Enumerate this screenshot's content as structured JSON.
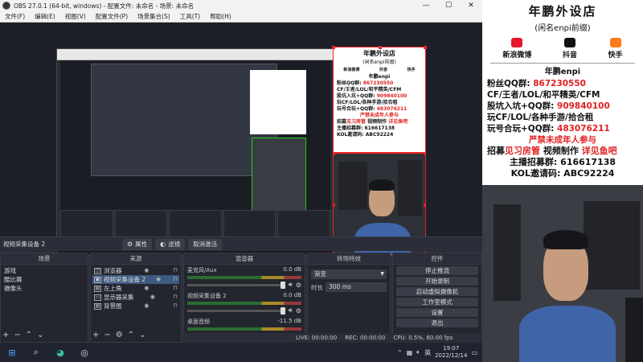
{
  "window": {
    "title": "OBS 27.0.1 (64-bit, windows) - 配置文件: 未命名 - 场景: 未命名",
    "controls": [
      "—",
      "☐",
      "✕"
    ]
  },
  "menu": [
    "文件(F)",
    "编辑(E)",
    "视图(V)",
    "配置文件(P)",
    "场景集合(S)",
    "工具(T)",
    "帮助(H)"
  ],
  "preview_header": {
    "source_name": "视频采集设备 2",
    "properties_label": "属性",
    "filters_label": "滤镜",
    "deactivate_label": "取消激活"
  },
  "scenes": {
    "title": "场景",
    "items": [
      "游戏",
      "酷比赛",
      "摄像头"
    ]
  },
  "sources": {
    "title": "来源",
    "items": [
      {
        "label": "浏览器",
        "icon": "browser-icon"
      },
      {
        "label": "视频采集设备 2",
        "icon": "camera-icon",
        "selected": true
      },
      {
        "label": "左上角",
        "icon": "image-icon"
      },
      {
        "label": "显示器采集",
        "icon": "monitor-icon"
      },
      {
        "label": "背景图",
        "icon": "image-icon"
      }
    ]
  },
  "mixer": {
    "title": "混音器",
    "channels": [
      {
        "name": "麦克风/Aux",
        "db": "0.0 dB"
      },
      {
        "name": "视频采集设备 2",
        "db": "0.0 dB"
      },
      {
        "name": "桌面音频",
        "db": "-11.5 dB"
      }
    ]
  },
  "transitions": {
    "title": "转场特效",
    "selected": "渐变",
    "duration_label": "时长",
    "duration_value": "300 ms"
  },
  "controls": {
    "title": "控件",
    "buttons": [
      "停止推流",
      "开始录制",
      "启动虚拟摄像机",
      "工作室模式",
      "设置",
      "退出"
    ]
  },
  "status": {
    "live": "LIVE: 00:00:00",
    "rec": "REC: 00:00:00",
    "cpu": "CPU: 0.5%, 60.00 fps"
  },
  "taskbar": {
    "time": "19:07",
    "date": "2022/12/14",
    "lang": "英"
  },
  "shop": {
    "title": "年鹏外设店",
    "subtitle": "(闲名enpi前缀)",
    "socials": [
      {
        "label": "新浪微博",
        "color": "#e6162d",
        "icon": "weibo-icon"
      },
      {
        "label": "抖音",
        "color": "#111111",
        "icon": "douyin-icon"
      },
      {
        "label": "快手",
        "color": "#ff7a1a",
        "icon": "kuaishou-icon"
      }
    ],
    "owner": "年鹏enpi",
    "lines": [
      {
        "label": "粉丝QQ群: ",
        "value": "867230550"
      },
      {
        "label": "CF/王者/LOL/和平精英/CFM",
        "value": ""
      },
      {
        "label": "股坑入坑+QQ群: ",
        "value": "909840100"
      },
      {
        "label": "玩CF/LOL/各种手游/拾合租",
        "value": ""
      },
      {
        "label": "玩号合玩+QQ群: ",
        "value": "483076211"
      }
    ],
    "warning": "严禁未成年人参与",
    "recruit_prefix": "招募",
    "recruit_red1": "见习房管",
    "recruit_mid": " 视频制作 ",
    "recruit_red2": "详见鱼吧",
    "anchor": "主播招募群: 616617138",
    "kol": "KOL邀请码: ABC92224"
  }
}
